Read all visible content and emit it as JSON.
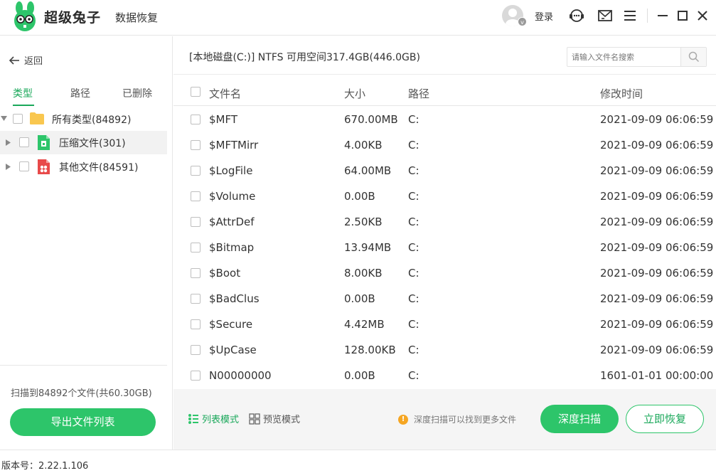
{
  "app": {
    "brand": "超级兔子",
    "brand_sub": "数据恢复",
    "login": "登录",
    "avatar_badge": "v"
  },
  "sidebar": {
    "back": "返回",
    "tabs": [
      "类型",
      "路径",
      "已删除"
    ],
    "active_tab": "类型",
    "tree": [
      {
        "label": "所有类型(84892)",
        "icon": "folder-icon"
      },
      {
        "label": "压缩文件(301)",
        "icon": "archive-file-icon"
      },
      {
        "label": "其他文件(84591)",
        "icon": "other-file-icon"
      }
    ],
    "scan_info": "扫描到84892个文件(共60.30GB)",
    "export_button": "导出文件列表"
  },
  "main": {
    "path_info": "[本地磁盘(C:)] NTFS 可用空间317.4GB(446.0GB)",
    "search_placeholder": "请输入文件名搜索",
    "columns": {
      "name": "文件名",
      "size": "大小",
      "path": "路径",
      "modified": "修改时间"
    },
    "rows": [
      {
        "name": "$MFT",
        "size": "670.00MB",
        "path": "C:",
        "modified": "2021-09-09 06:06:59"
      },
      {
        "name": "$MFTMirr",
        "size": "4.00KB",
        "path": "C:",
        "modified": "2021-09-09 06:06:59"
      },
      {
        "name": "$LogFile",
        "size": "64.00MB",
        "path": "C:",
        "modified": "2021-09-09 06:06:59"
      },
      {
        "name": "$Volume",
        "size": "0.00B",
        "path": "C:",
        "modified": "2021-09-09 06:06:59"
      },
      {
        "name": "$AttrDef",
        "size": "2.50KB",
        "path": "C:",
        "modified": "2021-09-09 06:06:59"
      },
      {
        "name": "$Bitmap",
        "size": "13.94MB",
        "path": "C:",
        "modified": "2021-09-09 06:06:59"
      },
      {
        "name": "$Boot",
        "size": "8.00KB",
        "path": "C:",
        "modified": "2021-09-09 06:06:59"
      },
      {
        "name": "$BadClus",
        "size": "0.00B",
        "path": "C:",
        "modified": "2021-09-09 06:06:59"
      },
      {
        "name": "$Secure",
        "size": "4.42MB",
        "path": "C:",
        "modified": "2021-09-09 06:06:59"
      },
      {
        "name": "$UpCase",
        "size": "128.00KB",
        "path": "C:",
        "modified": "2021-09-09 06:06:59"
      },
      {
        "name": "N00000000",
        "size": "0.00B",
        "path": "C:",
        "modified": "1601-01-01 00:00:00"
      }
    ],
    "modes": {
      "list": "列表模式",
      "preview": "预览模式",
      "active": "list"
    },
    "hint": "深度扫描可以找到更多文件",
    "deep_scan_button": "深度扫描",
    "recover_button": "立即恢复"
  },
  "footer": {
    "version": "版本号：2.22.1.106"
  },
  "colors": {
    "accent": "#2dc56a",
    "accent_text": "#1aa85a",
    "warning": "#f5a623"
  }
}
